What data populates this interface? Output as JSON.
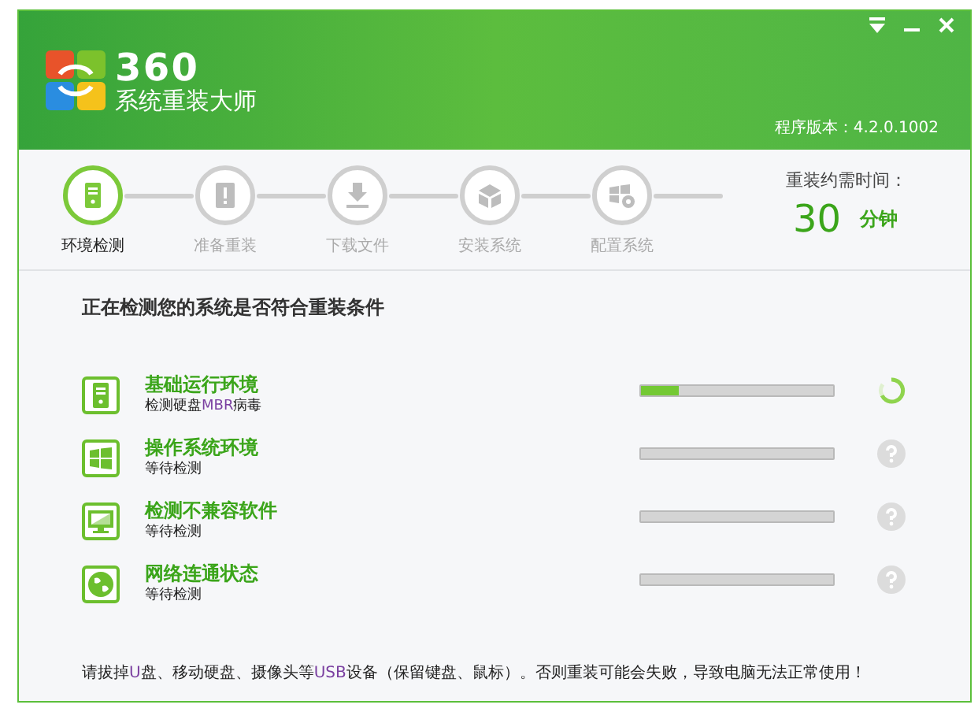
{
  "window": {
    "logo_number": "360",
    "logo_title": "系统重装大师",
    "version": "程序版本：4.2.0.1002"
  },
  "steps": [
    {
      "label": "环境检测",
      "active": true
    },
    {
      "label": "准备重装",
      "active": false
    },
    {
      "label": "下载文件",
      "active": false
    },
    {
      "label": "安装系统",
      "active": false
    },
    {
      "label": "配置系统",
      "active": false
    }
  ],
  "time_estimate": {
    "label": "重装约需时间：",
    "value": "30",
    "unit": "分钟"
  },
  "heading": "正在检测您的系统是否符合重装条件",
  "checks": [
    {
      "title": "基础运行环境",
      "detail": [
        {
          "text": "检测硬盘"
        },
        {
          "text": "MBR",
          "highlight": true
        },
        {
          "text": "病毒"
        }
      ],
      "in_progress": true,
      "level": 0.2
    },
    {
      "title": "操作系统环境",
      "detail": [
        {
          "text": "等待检测"
        }
      ],
      "in_progress": false
    },
    {
      "title": "检测不兼容软件",
      "detail": [
        {
          "text": "等待检测"
        }
      ],
      "in_progress": false
    },
    {
      "title": "网络连通状态",
      "detail": [
        {
          "text": "等待检测"
        }
      ],
      "in_progress": false
    }
  ],
  "notice": [
    {
      "text": "请拔掉"
    },
    {
      "text": "U",
      "highlight": true
    },
    {
      "text": "盘、移动硬盘、摄像头等"
    },
    {
      "text": "USB",
      "highlight": true
    },
    {
      "text": "设备（保留键盘、鼠标）。否则重装可能会失败，导致电脑无法正常使用！"
    }
  ]
}
